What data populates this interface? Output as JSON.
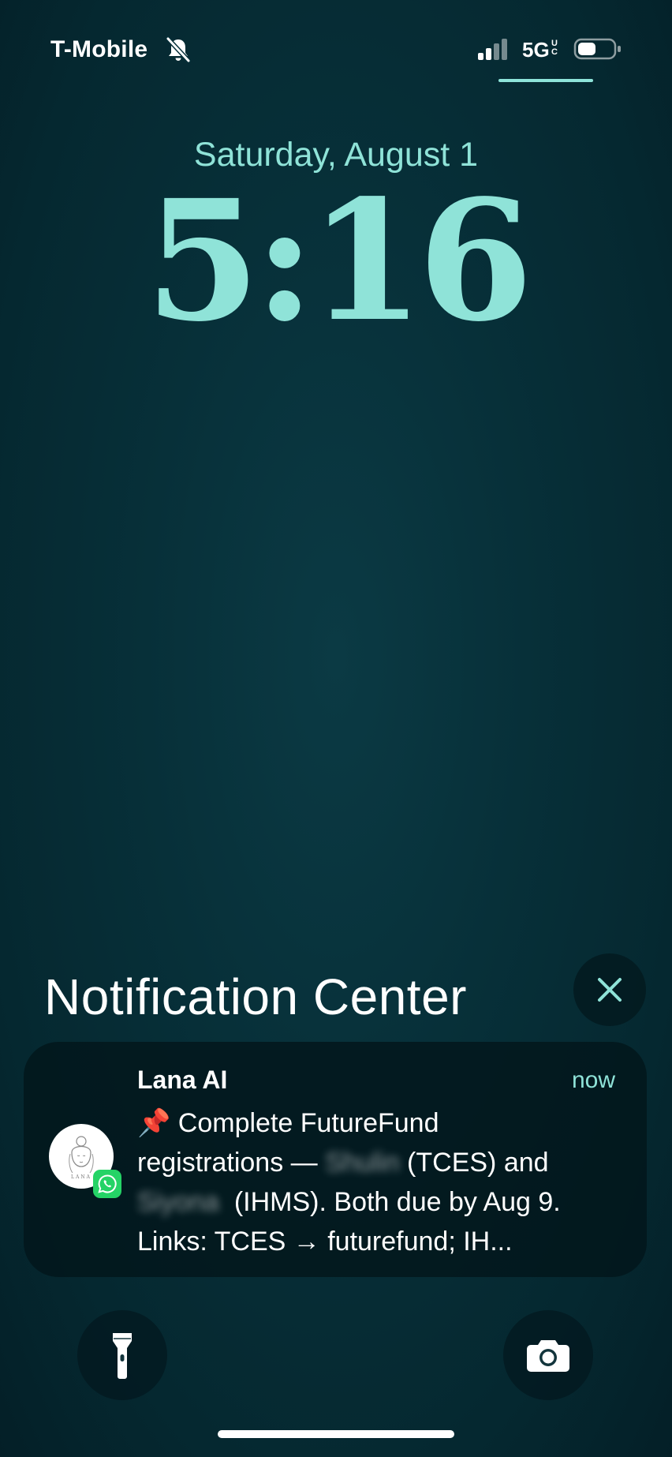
{
  "status_bar": {
    "carrier": "T-Mobile",
    "silent_icon": "bell-slash-icon",
    "signal_icon": "cellular-signal-icon",
    "network": "5G",
    "network_sub_top": "U",
    "network_sub_bottom": "C",
    "battery_icon": "battery-icon"
  },
  "lock_screen": {
    "date": "Saturday, August 1",
    "time": "5:16"
  },
  "notification_center": {
    "title": "Notification Center",
    "close_icon": "close-icon"
  },
  "notification": {
    "app_name": "Lana AI",
    "timestamp": "now",
    "avatar_caption": "LANA",
    "badge_icon": "whatsapp-icon",
    "body_line1": "📌 Complete FutureFund",
    "body_line2_a": "registrations — ",
    "body_line2_blur": "Shulin",
    "body_line2_b": " (TCES) and",
    "body_line3_blur": "Siyona",
    "body_line3_b": "  (IHMS). Both due by Aug 9.",
    "body_line4": "Links: TCES → futurefund; IH..."
  },
  "quick_actions": {
    "flashlight_icon": "flashlight-icon",
    "camera_icon": "camera-icon"
  },
  "colors": {
    "accent": "#8fe3d8",
    "background": "#063039",
    "whatsapp_green": "#25d366"
  }
}
